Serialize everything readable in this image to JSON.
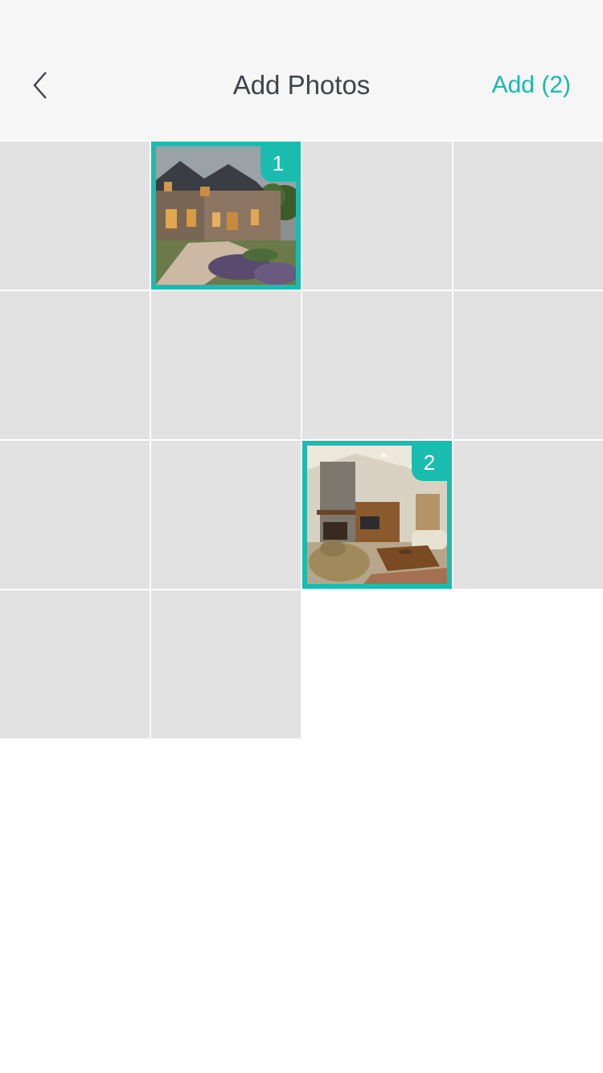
{
  "header": {
    "title": "Add Photos",
    "add_label": "Add (2)",
    "back_icon": "chevron-left-icon"
  },
  "colors": {
    "accent": "#1abcaf",
    "header_bg": "#f6f6f6",
    "placeholder": "#e2e2e2",
    "title_text": "#3f434a"
  },
  "grid": {
    "cells": [
      {
        "selected": false
      },
      {
        "selected": true,
        "order": "1",
        "photo": "house-exterior"
      },
      {
        "selected": false
      },
      {
        "selected": false
      },
      {
        "selected": false
      },
      {
        "selected": false
      },
      {
        "selected": false
      },
      {
        "selected": false
      },
      {
        "selected": false
      },
      {
        "selected": false
      },
      {
        "selected": true,
        "order": "2",
        "photo": "living-room"
      },
      {
        "selected": false
      },
      {
        "selected": false
      },
      {
        "selected": false
      }
    ]
  }
}
